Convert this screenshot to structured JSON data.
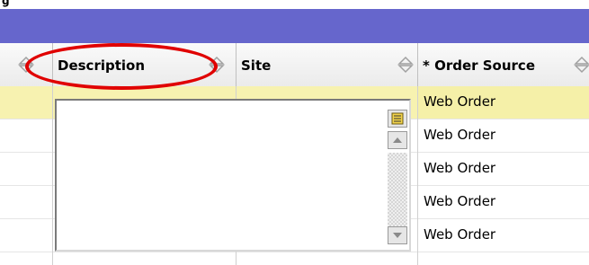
{
  "header": {
    "columns": [
      {
        "label": "Description"
      },
      {
        "label": "Site"
      },
      {
        "label": "* Order Source"
      }
    ]
  },
  "rows": [
    {
      "order_source": "Web Order",
      "selected": true
    },
    {
      "order_source": "Web Order",
      "selected": false
    },
    {
      "order_source": "Web Order",
      "selected": false
    },
    {
      "order_source": "Web Order",
      "selected": false
    },
    {
      "order_source": "Web Order",
      "selected": false
    }
  ],
  "description_editor": {
    "value": "",
    "icons": [
      "edit-icon",
      "scroll-up-icon",
      "scroll-down-icon"
    ]
  },
  "colors": {
    "title_bar": "#6666cc",
    "selected_row": "#f7f2b0",
    "annotation_oval": "#e00000"
  }
}
